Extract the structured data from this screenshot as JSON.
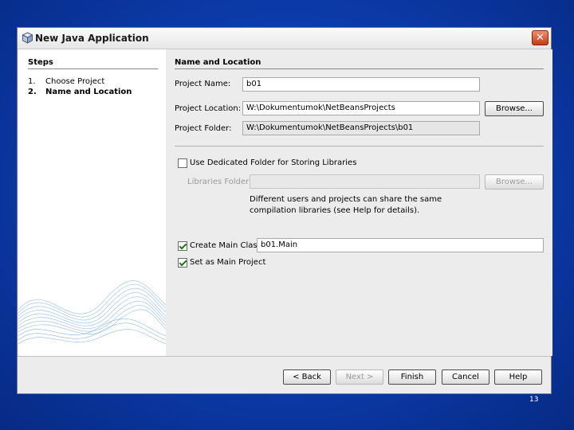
{
  "window": {
    "title": "New Java Application",
    "close_label": "✕"
  },
  "steps": {
    "heading": "Steps",
    "items": [
      {
        "num": "1.",
        "label": "Choose Project"
      },
      {
        "num": "2.",
        "label": "Name and Location"
      }
    ]
  },
  "main": {
    "heading": "Name and Location",
    "project_name": {
      "label": "Project Name:",
      "value": "b01"
    },
    "project_location": {
      "label": "Project Location:",
      "value": "W:\\Dokumentumok\\NetBeansProjects",
      "browse_label": "Browse..."
    },
    "project_folder": {
      "label": "Project Folder:",
      "value": "W:\\Dokumentumok\\NetBeansProjects\\b01"
    },
    "dedicated_folder": {
      "label": "Use Dedicated Folder for Storing Libraries",
      "checked": false
    },
    "libraries_folder": {
      "label": "Libraries Folder:",
      "value": "",
      "browse_label": "Browse..."
    },
    "hint": "Different users and projects can share the same compilation libraries (see Help for details).",
    "create_main_class": {
      "label": "Create Main Class",
      "value": "b01.Main",
      "checked": true
    },
    "set_main_project": {
      "label": "Set as Main Project",
      "checked": true
    }
  },
  "buttons": {
    "back": "< Back",
    "next": "Next >",
    "finish": "Finish",
    "cancel": "Cancel",
    "help": "Help"
  },
  "slide_number": "13"
}
